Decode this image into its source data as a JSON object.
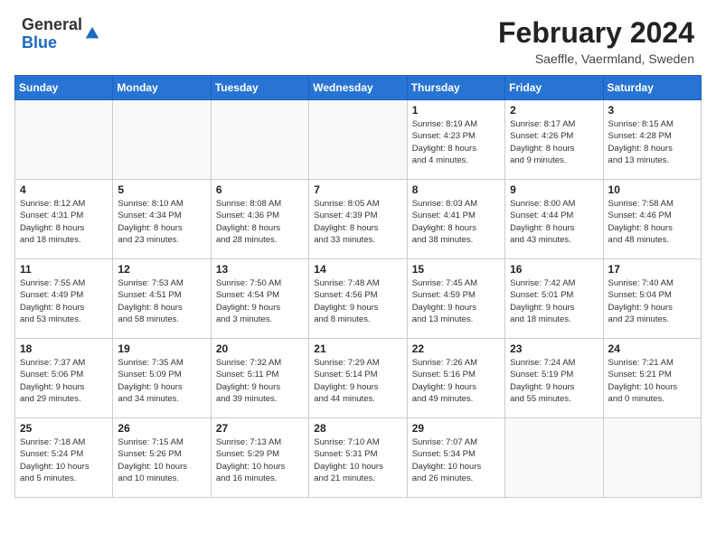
{
  "header": {
    "logo_general": "General",
    "logo_blue": "Blue",
    "main_title": "February 2024",
    "subtitle": "Saeffle, Vaermland, Sweden"
  },
  "weekdays": [
    "Sunday",
    "Monday",
    "Tuesday",
    "Wednesday",
    "Thursday",
    "Friday",
    "Saturday"
  ],
  "weeks": [
    [
      {
        "day": "",
        "info": ""
      },
      {
        "day": "",
        "info": ""
      },
      {
        "day": "",
        "info": ""
      },
      {
        "day": "",
        "info": ""
      },
      {
        "day": "1",
        "info": "Sunrise: 8:19 AM\nSunset: 4:23 PM\nDaylight: 8 hours\nand 4 minutes."
      },
      {
        "day": "2",
        "info": "Sunrise: 8:17 AM\nSunset: 4:26 PM\nDaylight: 8 hours\nand 9 minutes."
      },
      {
        "day": "3",
        "info": "Sunrise: 8:15 AM\nSunset: 4:28 PM\nDaylight: 8 hours\nand 13 minutes."
      }
    ],
    [
      {
        "day": "4",
        "info": "Sunrise: 8:12 AM\nSunset: 4:31 PM\nDaylight: 8 hours\nand 18 minutes."
      },
      {
        "day": "5",
        "info": "Sunrise: 8:10 AM\nSunset: 4:34 PM\nDaylight: 8 hours\nand 23 minutes."
      },
      {
        "day": "6",
        "info": "Sunrise: 8:08 AM\nSunset: 4:36 PM\nDaylight: 8 hours\nand 28 minutes."
      },
      {
        "day": "7",
        "info": "Sunrise: 8:05 AM\nSunset: 4:39 PM\nDaylight: 8 hours\nand 33 minutes."
      },
      {
        "day": "8",
        "info": "Sunrise: 8:03 AM\nSunset: 4:41 PM\nDaylight: 8 hours\nand 38 minutes."
      },
      {
        "day": "9",
        "info": "Sunrise: 8:00 AM\nSunset: 4:44 PM\nDaylight: 8 hours\nand 43 minutes."
      },
      {
        "day": "10",
        "info": "Sunrise: 7:58 AM\nSunset: 4:46 PM\nDaylight: 8 hours\nand 48 minutes."
      }
    ],
    [
      {
        "day": "11",
        "info": "Sunrise: 7:55 AM\nSunset: 4:49 PM\nDaylight: 8 hours\nand 53 minutes."
      },
      {
        "day": "12",
        "info": "Sunrise: 7:53 AM\nSunset: 4:51 PM\nDaylight: 8 hours\nand 58 minutes."
      },
      {
        "day": "13",
        "info": "Sunrise: 7:50 AM\nSunset: 4:54 PM\nDaylight: 9 hours\nand 3 minutes."
      },
      {
        "day": "14",
        "info": "Sunrise: 7:48 AM\nSunset: 4:56 PM\nDaylight: 9 hours\nand 8 minutes."
      },
      {
        "day": "15",
        "info": "Sunrise: 7:45 AM\nSunset: 4:59 PM\nDaylight: 9 hours\nand 13 minutes."
      },
      {
        "day": "16",
        "info": "Sunrise: 7:42 AM\nSunset: 5:01 PM\nDaylight: 9 hours\nand 18 minutes."
      },
      {
        "day": "17",
        "info": "Sunrise: 7:40 AM\nSunset: 5:04 PM\nDaylight: 9 hours\nand 23 minutes."
      }
    ],
    [
      {
        "day": "18",
        "info": "Sunrise: 7:37 AM\nSunset: 5:06 PM\nDaylight: 9 hours\nand 29 minutes."
      },
      {
        "day": "19",
        "info": "Sunrise: 7:35 AM\nSunset: 5:09 PM\nDaylight: 9 hours\nand 34 minutes."
      },
      {
        "day": "20",
        "info": "Sunrise: 7:32 AM\nSunset: 5:11 PM\nDaylight: 9 hours\nand 39 minutes."
      },
      {
        "day": "21",
        "info": "Sunrise: 7:29 AM\nSunset: 5:14 PM\nDaylight: 9 hours\nand 44 minutes."
      },
      {
        "day": "22",
        "info": "Sunrise: 7:26 AM\nSunset: 5:16 PM\nDaylight: 9 hours\nand 49 minutes."
      },
      {
        "day": "23",
        "info": "Sunrise: 7:24 AM\nSunset: 5:19 PM\nDaylight: 9 hours\nand 55 minutes."
      },
      {
        "day": "24",
        "info": "Sunrise: 7:21 AM\nSunset: 5:21 PM\nDaylight: 10 hours\nand 0 minutes."
      }
    ],
    [
      {
        "day": "25",
        "info": "Sunrise: 7:18 AM\nSunset: 5:24 PM\nDaylight: 10 hours\nand 5 minutes."
      },
      {
        "day": "26",
        "info": "Sunrise: 7:15 AM\nSunset: 5:26 PM\nDaylight: 10 hours\nand 10 minutes."
      },
      {
        "day": "27",
        "info": "Sunrise: 7:13 AM\nSunset: 5:29 PM\nDaylight: 10 hours\nand 16 minutes."
      },
      {
        "day": "28",
        "info": "Sunrise: 7:10 AM\nSunset: 5:31 PM\nDaylight: 10 hours\nand 21 minutes."
      },
      {
        "day": "29",
        "info": "Sunrise: 7:07 AM\nSunset: 5:34 PM\nDaylight: 10 hours\nand 26 minutes."
      },
      {
        "day": "",
        "info": ""
      },
      {
        "day": "",
        "info": ""
      }
    ]
  ]
}
